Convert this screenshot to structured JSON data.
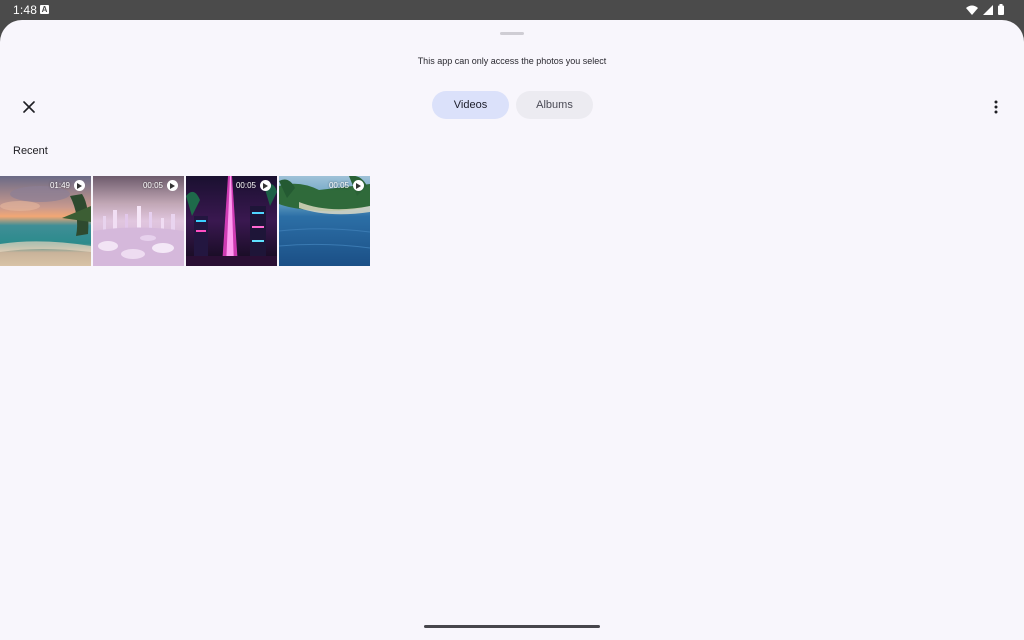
{
  "status_bar": {
    "time": "1:48",
    "notification_icon": "a-badge-icon",
    "icons": [
      "wifi-icon",
      "signal-icon",
      "battery-icon"
    ]
  },
  "sheet": {
    "notice": "This app can only access the photos you select",
    "tabs": [
      {
        "label": "Videos",
        "active": true
      },
      {
        "label": "Albums",
        "active": false
      }
    ],
    "close_icon": "close-icon",
    "menu_icon": "more-vert-icon"
  },
  "section": {
    "title": "Recent"
  },
  "videos": [
    {
      "duration": "01:49",
      "scene": "sunset-beach"
    },
    {
      "duration": "00:05",
      "scene": "pink-crystal-city"
    },
    {
      "duration": "00:05",
      "scene": "neon-tower-city"
    },
    {
      "duration": "00:05",
      "scene": "tropical-sea"
    }
  ],
  "colors": {
    "accent_tab": "#dbe1fa",
    "inactive_tab": "#ecebf1",
    "sheet_bg": "#f8f6fc"
  }
}
